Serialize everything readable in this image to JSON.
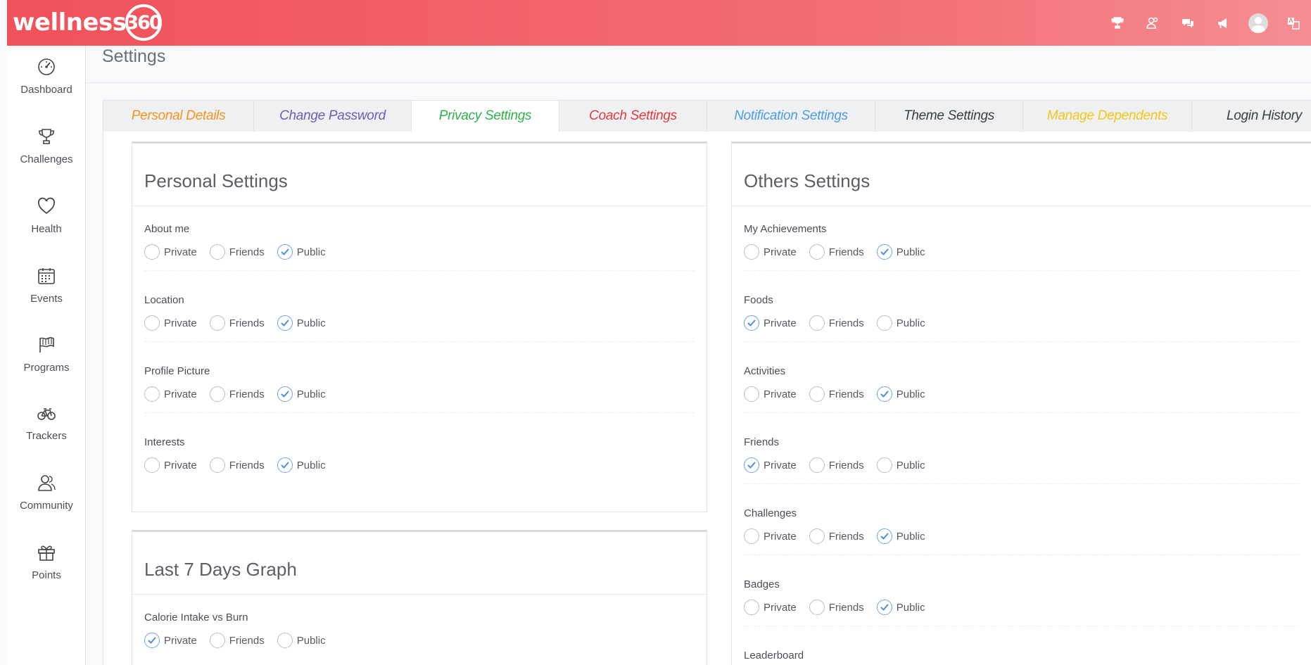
{
  "header": {
    "logo_text": "wellness",
    "logo_number": "360",
    "icons": [
      "trophy-icon",
      "community-icon",
      "chat-icon",
      "megaphone-icon",
      "avatar",
      "language-icon"
    ],
    "gradient": [
      "#f0515a",
      "#f58e93"
    ]
  },
  "sidebar": {
    "items": [
      {
        "label": "Dashboard",
        "icon": "speedometer-icon"
      },
      {
        "label": "Challenges",
        "icon": "trophy-icon"
      },
      {
        "label": "Health",
        "icon": "heart-icon"
      },
      {
        "label": "Events",
        "icon": "calendar-icon"
      },
      {
        "label": "Programs",
        "icon": "flag-icon"
      },
      {
        "label": "Trackers",
        "icon": "bicycle-icon"
      },
      {
        "label": "Community",
        "icon": "people-icon"
      },
      {
        "label": "Points",
        "icon": "gift-icon"
      }
    ]
  },
  "page": {
    "title": "Settings"
  },
  "tabs": [
    {
      "label": "Personal Details",
      "color": "#f7931e"
    },
    {
      "label": "Change Password",
      "color": "#6a5fb4"
    },
    {
      "label": "Privacy Settings",
      "color": "#2db24a",
      "active": true
    },
    {
      "label": "Coach Settings",
      "color": "#e8393f"
    },
    {
      "label": "Notification Settings",
      "color": "#4d9de0"
    },
    {
      "label": "Theme Settings",
      "color": "#3a3e45"
    },
    {
      "label": "Manage Dependents",
      "color": "#f5c518"
    },
    {
      "label": "Login History",
      "color": "#3a3e45"
    }
  ],
  "options": {
    "private": "Private",
    "friends": "Friends",
    "public": "Public"
  },
  "personal_settings": {
    "title": "Personal Settings",
    "groups": [
      {
        "label": "About me",
        "selected": "Public"
      },
      {
        "label": "Location",
        "selected": "Public"
      },
      {
        "label": "Profile Picture",
        "selected": "Public"
      },
      {
        "label": "Interests",
        "selected": "Public"
      }
    ]
  },
  "graph_settings": {
    "title": "Last 7 Days Graph",
    "groups": [
      {
        "label": "Calorie Intake vs Burn",
        "selected": "Private"
      }
    ]
  },
  "others_settings": {
    "title": "Others Settings",
    "groups": [
      {
        "label": "My Achievements",
        "selected": "Public"
      },
      {
        "label": "Foods",
        "selected": "Private"
      },
      {
        "label": "Activities",
        "selected": "Public"
      },
      {
        "label": "Friends",
        "selected": "Private"
      },
      {
        "label": "Challenges",
        "selected": "Public"
      },
      {
        "label": "Badges",
        "selected": "Public"
      },
      {
        "label": "Leaderboard",
        "selected": ""
      }
    ]
  },
  "colors": {
    "check": "#4d8fd6"
  }
}
